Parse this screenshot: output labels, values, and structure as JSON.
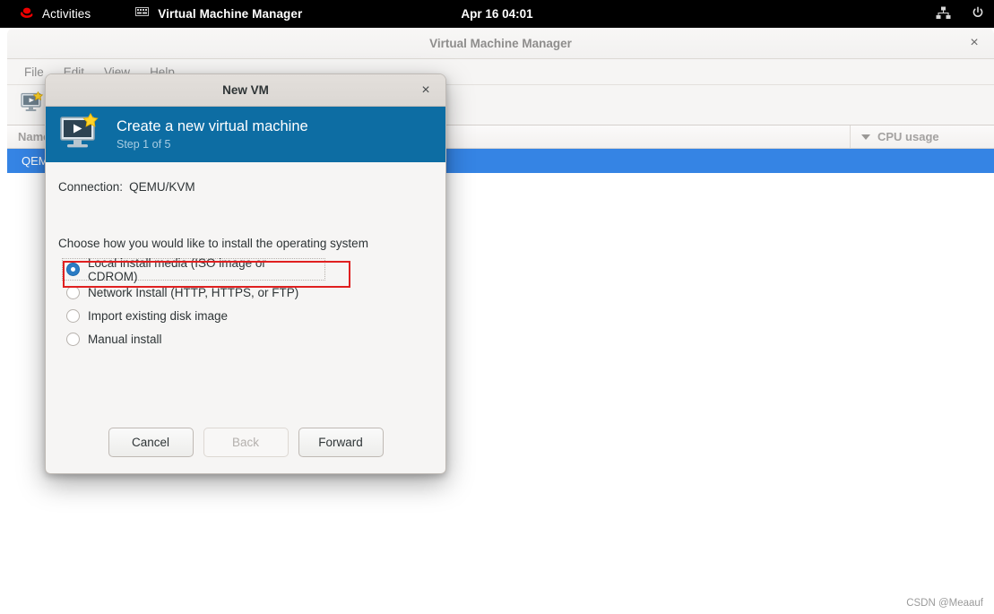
{
  "topbar": {
    "activities_label": "Activities",
    "app_label": "Virtual Machine Manager",
    "clock": "Apr 16  04:01",
    "network_icon": "network-sitemap-icon",
    "power_icon": "power-icon",
    "redhat_icon": "redhat-logo-icon",
    "app_icon": "vm-icon"
  },
  "window": {
    "title": "Virtual Machine Manager",
    "close_label": "×",
    "menu": [
      {
        "label": "File"
      },
      {
        "label": "Edit"
      },
      {
        "label": "View"
      },
      {
        "label": "Help"
      }
    ],
    "toolbar": {
      "new_vm_icon": "new-vm-icon"
    },
    "columns": [
      {
        "label": "Name"
      },
      {
        "label": "CPU usage"
      }
    ],
    "rows": [
      {
        "name": "QEMU/KVM",
        "cpu": ""
      }
    ]
  },
  "dialog": {
    "title": "New VM",
    "close_label": "×",
    "banner": {
      "heading": "Create a new virtual machine",
      "step": "Step 1 of 5",
      "icon": "new-vm-icon"
    },
    "connection_label": "Connection:",
    "connection_value": "QEMU/KVM",
    "choose_label": "Choose how you would like to install the operating system",
    "options": [
      {
        "label": "Local install media (ISO image or CDROM)",
        "selected": true
      },
      {
        "label": "Network Install (HTTP, HTTPS, or FTP)",
        "selected": false
      },
      {
        "label": "Import existing disk image",
        "selected": false
      },
      {
        "label": "Manual install",
        "selected": false
      }
    ],
    "buttons": {
      "cancel": "Cancel",
      "back": "Back",
      "forward": "Forward"
    }
  },
  "watermark": "CSDN @Meaauf",
  "colors": {
    "banner_blue": "#0d6da3",
    "selection_blue": "#3584e4",
    "radio_blue": "#2b7cc4",
    "annotation_red": "#e02020"
  }
}
